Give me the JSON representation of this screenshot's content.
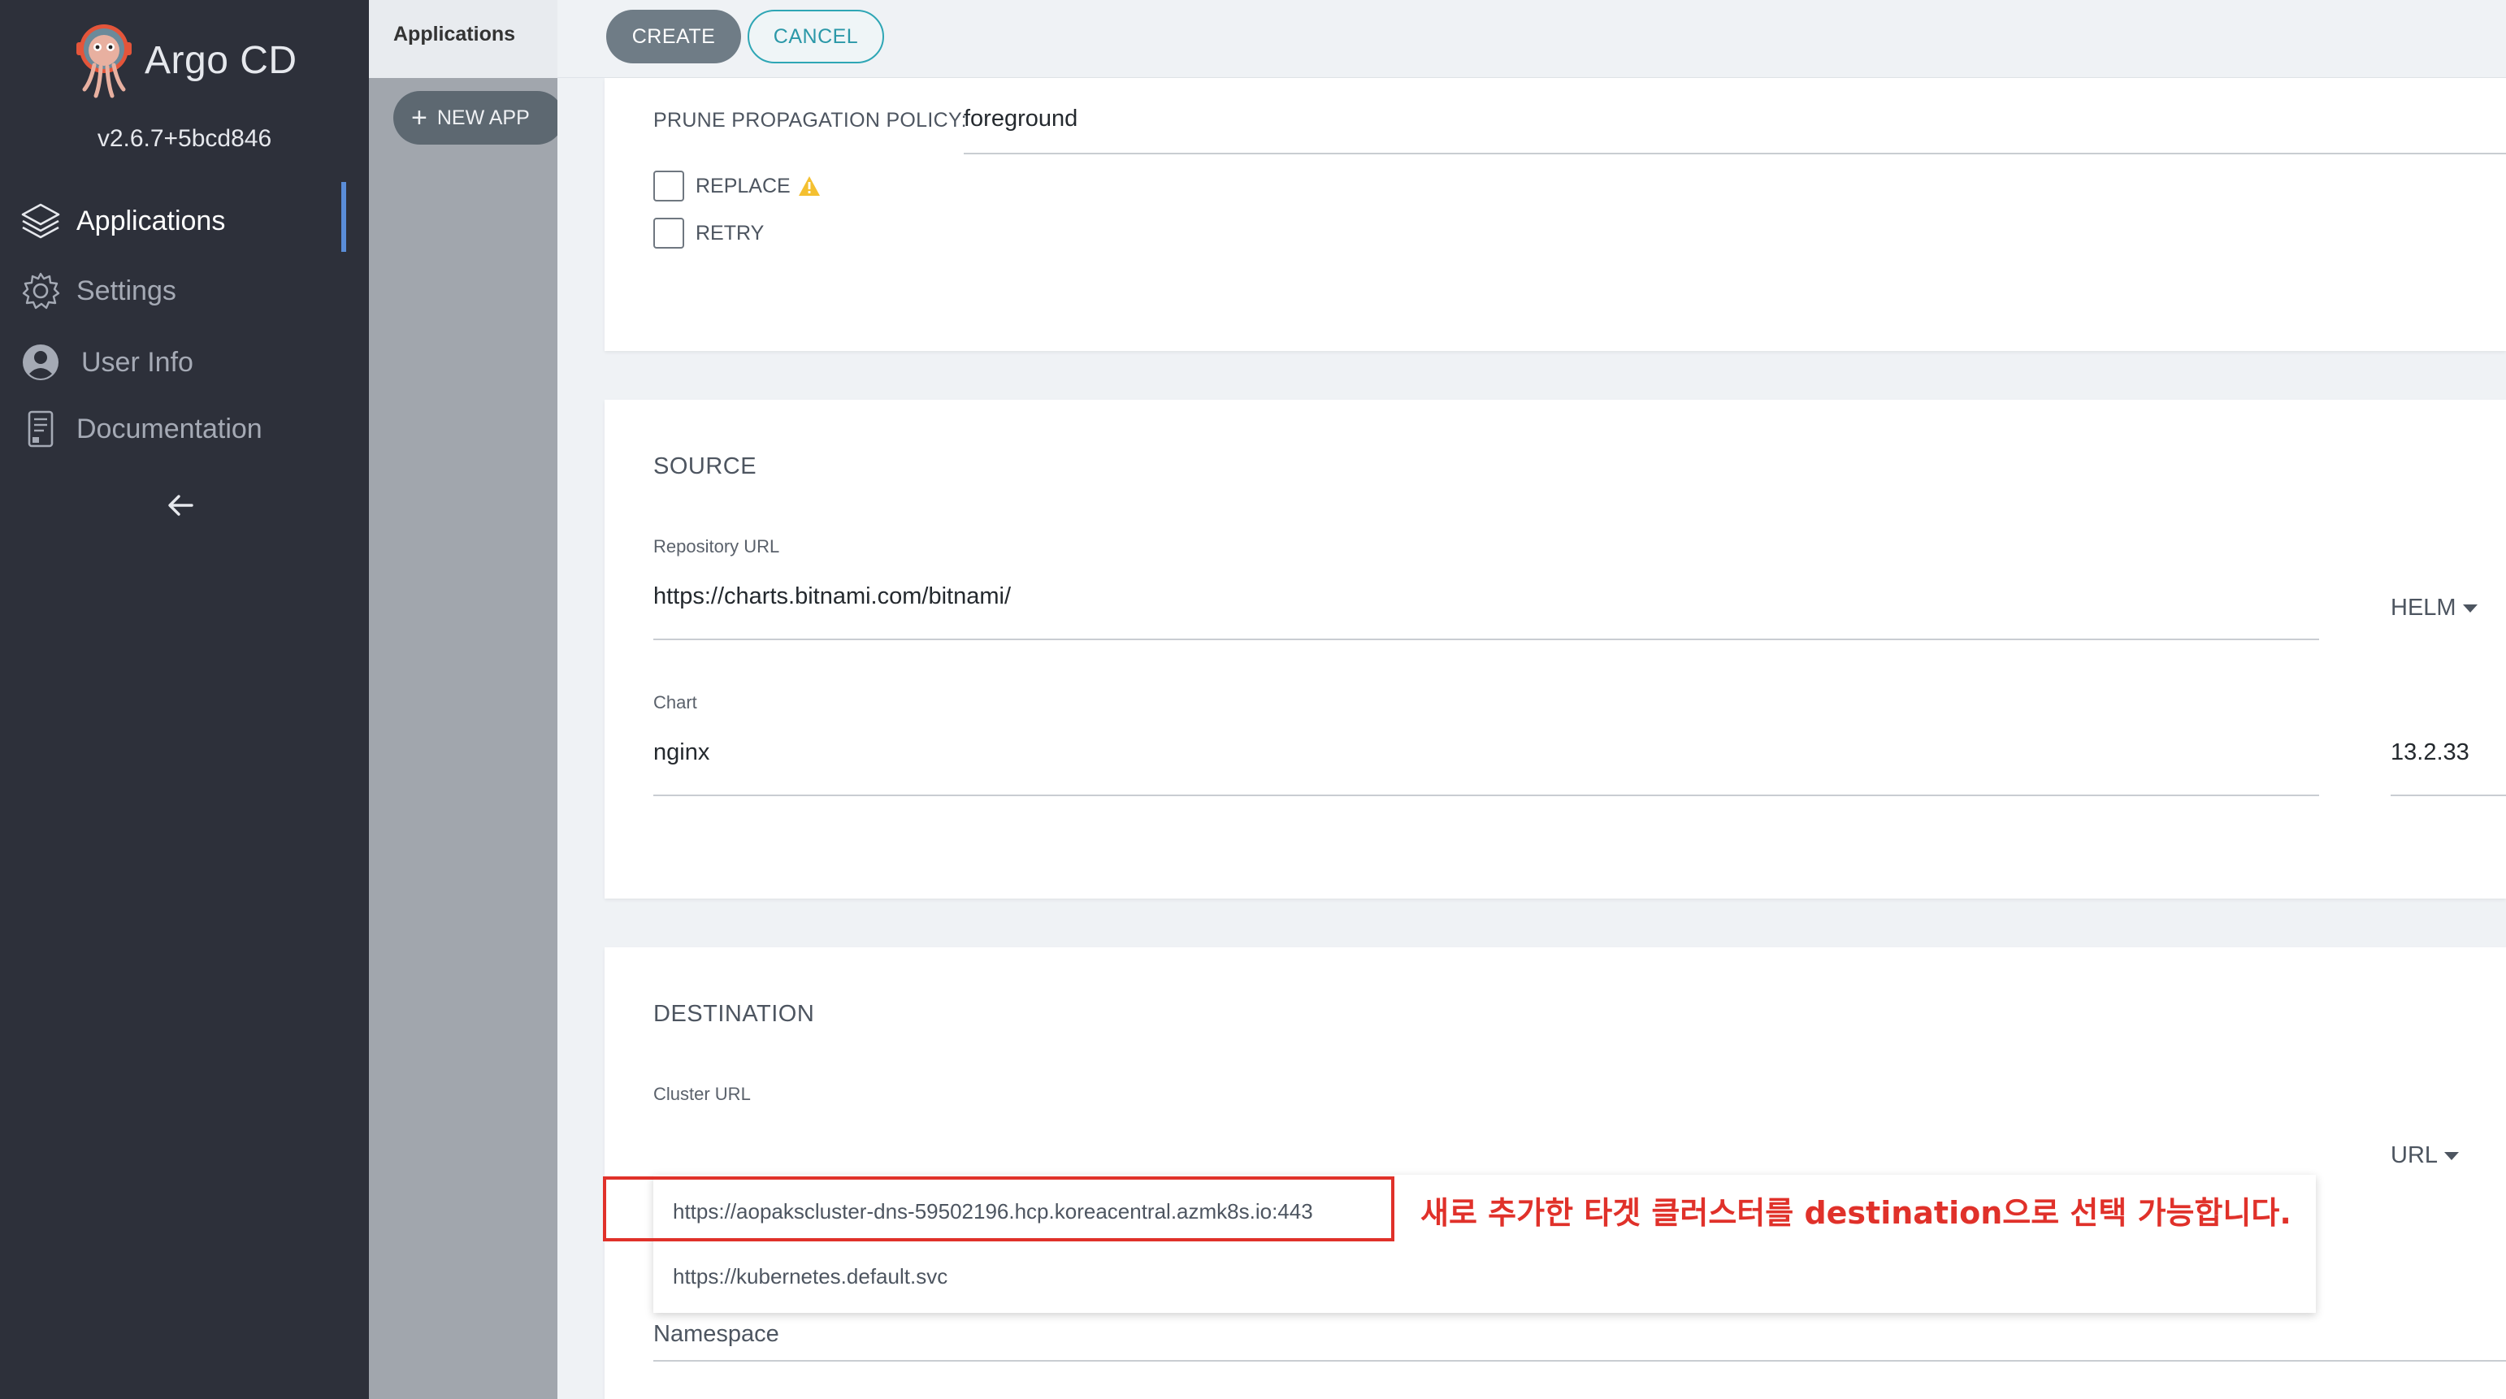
{
  "sidebar": {
    "brand": "Argo CD",
    "version": "v2.6.7+5bcd846",
    "items": [
      {
        "label": "Applications",
        "icon": "layers-icon",
        "active": true
      },
      {
        "label": "Settings",
        "icon": "gear-icon",
        "active": false
      },
      {
        "label": "User Info",
        "icon": "user-icon",
        "active": false
      },
      {
        "label": "Documentation",
        "icon": "book-icon",
        "active": false
      }
    ],
    "collapse_icon": "arrow-left-icon"
  },
  "apps_column": {
    "title": "Applications",
    "new_app_label": "NEW APP"
  },
  "toolbar": {
    "create_label": "CREATE",
    "cancel_label": "CANCEL"
  },
  "sync_options": {
    "prune_policy_label": "PRUNE PROPAGATION POLICY:",
    "prune_policy_value": "foreground",
    "replace_label": "REPLACE",
    "retry_label": "RETRY"
  },
  "source": {
    "title": "SOURCE",
    "repo_label": "Repository URL",
    "repo_value": "https://charts.bitnami.com/bitnami/",
    "repo_type": "HELM",
    "chart_label": "Chart",
    "chart_value": "nginx",
    "chart_version": "13.2.33"
  },
  "destination": {
    "title": "DESTINATION",
    "cluster_label": "Cluster URL",
    "cluster_type": "URL",
    "suggestions": [
      "https://aopakscluster-dns-59502196.hcp.koreacentral.azmk8s.io:443",
      "https://kubernetes.default.svc"
    ],
    "namespace_placeholder": "Namespace"
  },
  "annotation": "새로 추가한 타겟 클러스터를 destination으로 선택 가능합니다.",
  "colors": {
    "sidebar_bg": "#2d303a",
    "accent_teal": "#2ea6b5",
    "annotation_red": "#e0312a",
    "warning_yellow": "#f4c030"
  }
}
